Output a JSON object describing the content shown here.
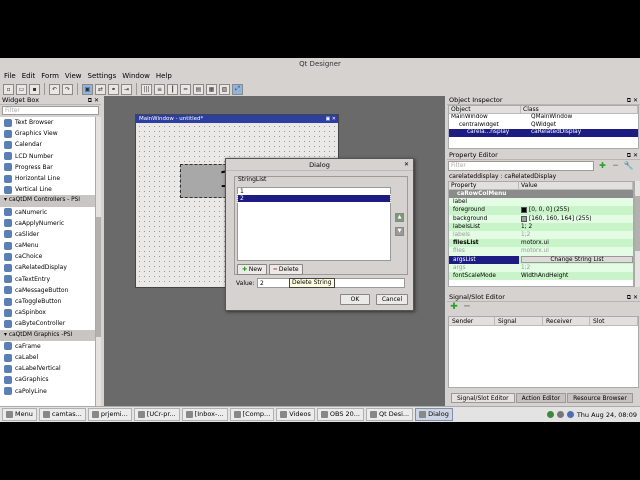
{
  "window": {
    "title": "Qt Designer"
  },
  "menubar": [
    "File",
    "Edit",
    "Form",
    "View",
    "Settings",
    "Window",
    "Help"
  ],
  "widgetbox": {
    "title": "Widget Box",
    "filter_placeholder": "Filter",
    "items": [
      {
        "label": "Text Browser",
        "category": false
      },
      {
        "label": "Graphics View",
        "category": false
      },
      {
        "label": "Calendar",
        "category": false
      },
      {
        "label": "LCD Number",
        "category": false
      },
      {
        "label": "Progress Bar",
        "category": false
      },
      {
        "label": "Horizontal Line",
        "category": false
      },
      {
        "label": "Vertical Line",
        "category": false
      },
      {
        "label": "caQtDM Controllers - PSI",
        "category": true
      },
      {
        "label": "caNumeric",
        "category": false
      },
      {
        "label": "caApplyNumeric",
        "category": false
      },
      {
        "label": "caSlider",
        "category": false
      },
      {
        "label": "caMenu",
        "category": false
      },
      {
        "label": "caChoice",
        "category": false
      },
      {
        "label": "caRelatedDisplay",
        "category": false
      },
      {
        "label": "caTextEntry",
        "category": false
      },
      {
        "label": "caMessageButton",
        "category": false
      },
      {
        "label": "caToggleButton",
        "category": false
      },
      {
        "label": "caSpinbox",
        "category": false
      },
      {
        "label": "caByteController",
        "category": false
      },
      {
        "label": "caQtDM Graphics -PSI",
        "category": true
      },
      {
        "label": "caFrame",
        "category": false
      },
      {
        "label": "caLabel",
        "category": false
      },
      {
        "label": "caLabelVertical",
        "category": false
      },
      {
        "label": "caGraphics",
        "category": false
      },
      {
        "label": "caPolyLine",
        "category": false
      }
    ]
  },
  "mainwindow": {
    "title": "MainWindow - untitled*",
    "widget_text": "1"
  },
  "dialog": {
    "title": "Dialog",
    "group_label": "StringList",
    "strings": [
      "1",
      "2"
    ],
    "selected_index": 1,
    "new_label": "New",
    "delete_label": "Delete",
    "value_label": "Value:",
    "value": "2",
    "tooltip": "Delete String",
    "ok_label": "OK",
    "cancel_label": "Cancel"
  },
  "object_inspector": {
    "title": "Object Inspector",
    "columns": [
      "Object",
      "Class"
    ],
    "rows": [
      {
        "object": "MainWindow",
        "class": "QMainWindow",
        "indent": 0,
        "selected": false
      },
      {
        "object": "centralwidget",
        "class": "QWidget",
        "indent": 1,
        "selected": false
      },
      {
        "object": "carela...nsplay",
        "class": "caRelatedDisplay",
        "indent": 2,
        "selected": true
      }
    ]
  },
  "property_editor": {
    "title": "Property Editor",
    "filter_placeholder": "Filter",
    "subtitle": "carelateddisplay : caRelatedDisplay",
    "columns": [
      "Property",
      "Value"
    ],
    "rows": [
      {
        "name": "caRowColMenu",
        "value": "",
        "style": "cat"
      },
      {
        "name": "label",
        "value": "",
        "style": "g2"
      },
      {
        "name": "foreground",
        "value": "[0, 0, 0] (255)",
        "style": "g1",
        "swatch": "#000000"
      },
      {
        "name": "background",
        "value": "[160, 160, 164] (255)",
        "style": "g2",
        "swatch": "#a0a0a4"
      },
      {
        "name": "labelsList",
        "value": "1; 2",
        "style": "g1"
      },
      {
        "name": "labels",
        "value": "1;2",
        "style": "g2",
        "gray": true
      },
      {
        "name": "filesList",
        "value": "motorx.ui",
        "style": "g1",
        "bold": true
      },
      {
        "name": "files",
        "value": "motorx.ui",
        "style": "g2",
        "gray": true
      },
      {
        "name": "argsList",
        "value": "Change String List",
        "style": "g1",
        "selected": true,
        "button": true
      },
      {
        "name": "args",
        "value": "1;2",
        "style": "g2",
        "gray": true
      },
      {
        "name": "fontScaleMode",
        "value": "WidthAndHeight",
        "style": "g1"
      }
    ]
  },
  "signal_slot": {
    "title": "Signal/Slot Editor",
    "columns": [
      "Sender",
      "Signal",
      "Receiver",
      "Slot"
    ],
    "tabs": [
      "Signal/Slot Editor",
      "Action Editor",
      "Resource Browser"
    ]
  },
  "taskbar": {
    "items": [
      {
        "label": "Menu",
        "active": false
      },
      {
        "label": "camtas...",
        "active": false
      },
      {
        "label": "prjemi...",
        "active": false
      },
      {
        "label": "[UCr-pr...",
        "active": false
      },
      {
        "label": "[Inbox-...",
        "active": false
      },
      {
        "label": "[Comp...",
        "active": false
      },
      {
        "label": "Videos",
        "active": false
      },
      {
        "label": "OBS 20...",
        "active": false
      },
      {
        "label": "Qt Desi...",
        "active": false
      },
      {
        "label": "Dialog",
        "active": true
      }
    ],
    "clock": "Thu Aug 24, 08:09"
  }
}
